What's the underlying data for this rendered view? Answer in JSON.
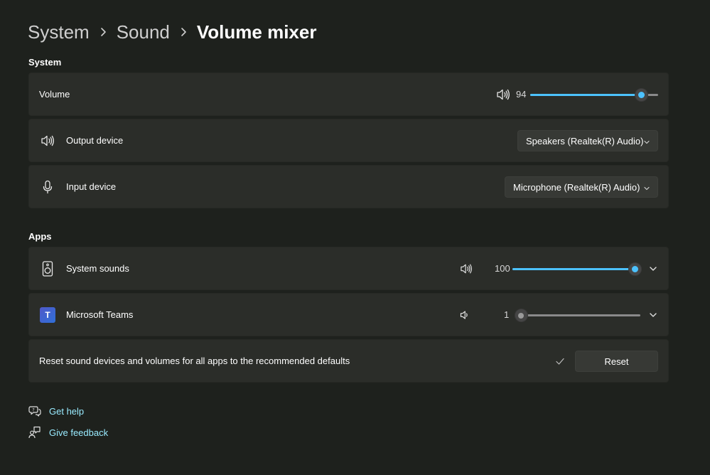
{
  "breadcrumb": {
    "items": [
      "System",
      "Sound",
      "Volume mixer"
    ]
  },
  "system_section": {
    "title": "System",
    "volume": {
      "label": "Volume",
      "value": "94",
      "level": 0.94
    },
    "output_device": {
      "label": "Output device",
      "selected": "Speakers (Realtek(R) Audio)"
    },
    "input_device": {
      "label": "Input device",
      "selected": "Microphone (Realtek(R) Audio)"
    }
  },
  "apps_section": {
    "title": "Apps",
    "apps": [
      {
        "name": "System sounds",
        "value": "100",
        "level": 1.0,
        "icon": "speaker-box-icon"
      },
      {
        "name": "Microsoft Teams",
        "value": "1",
        "level": 0.01,
        "icon": "teams-logo-icon",
        "logo_letter": "T"
      }
    ],
    "reset": {
      "label": "Reset sound devices and volumes for all apps to the recommended defaults",
      "button": "Reset"
    }
  },
  "links": {
    "help": "Get help",
    "feedback": "Give feedback"
  },
  "colors": {
    "background": "#1e211d",
    "card": "#2b2d29",
    "accent": "#4cc2ff",
    "link": "#99ebff"
  }
}
